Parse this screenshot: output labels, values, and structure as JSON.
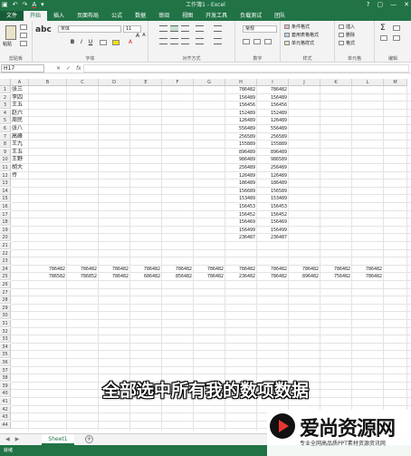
{
  "titlebar": {
    "title": "工作簿1 - Excel",
    "save_icon": "save-icon",
    "undo_icon": "undo-icon",
    "redo_icon": "redo-icon",
    "font_color_icon": "font-color-icon",
    "help_glyph": "?",
    "restore_glyph": "▢",
    "min_glyph": "—",
    "close_glyph": "✕"
  },
  "ribbon_tabs": [
    "文件",
    "开始",
    "插入",
    "页面布局",
    "公式",
    "数据",
    "审阅",
    "视图",
    "开发工具",
    "负载测试",
    "团队"
  ],
  "ribbon": {
    "paste_label": "粘贴",
    "clipboard_label": "剪贴板",
    "font_name": "宋体",
    "font_size": "11",
    "font_label": "字体",
    "bold": "B",
    "italic": "I",
    "underline": "U",
    "grow_font": "A",
    "shrink_font": "A",
    "align_label": "对齐方式",
    "number_format": "常规",
    "number_label": "数字",
    "conditional": "条件格式",
    "table_format": "套用表格格式",
    "cell_styles": "单元格样式",
    "styles_label": "样式",
    "insert": "插入",
    "delete": "删除",
    "format": "格式",
    "cells_label": "单元格",
    "editing_label": "编辑",
    "sum_glyph": "Σ"
  },
  "formula_bar": {
    "name_box": "H17",
    "cancel": "✕",
    "enter": "✓",
    "fx": "fx",
    "value": ""
  },
  "grid": {
    "columns": [
      "A",
      "B",
      "C",
      "D",
      "E",
      "F",
      "G",
      "H",
      "I",
      "J",
      "K",
      "L",
      "M"
    ],
    "rows_count": 44,
    "names": [
      "张三",
      "李四",
      "王五",
      "赵六",
      "周民",
      "张八",
      "高峰",
      "王九",
      "王五",
      "王野",
      "胡大",
      "传"
    ],
    "col_g": [
      "786482",
      "156489",
      "156456",
      "152489",
      "126489",
      "556489",
      "256589",
      "155889",
      "896489",
      "986489",
      "256489",
      "126489",
      "186489",
      "156689",
      "153489",
      "156453",
      "156452",
      "156469",
      "156499",
      "236487"
    ],
    "col_h": [
      "786482",
      "156489",
      "156456",
      "152489",
      "126489",
      "556489",
      "256589",
      "155889",
      "896489",
      "986589",
      "256489",
      "126489",
      "186489",
      "156589",
      "153489",
      "156453",
      "156452",
      "156469",
      "156499",
      "236487"
    ],
    "row24": [
      "786482",
      "786482",
      "786482",
      "786482",
      "786482",
      "786482",
      "786482",
      "786482",
      "786482",
      "786482",
      "786482"
    ],
    "row25": [
      "786582",
      "786852",
      "786482",
      "686482",
      "856482",
      "786482",
      "236482",
      "786482",
      "896482",
      "756482",
      "786482"
    ]
  },
  "sheets": {
    "nav_prev": "◀",
    "nav_next": "▶",
    "tabs": [
      "Sheet1"
    ],
    "add": "+"
  },
  "status": {
    "text": "就绪"
  },
  "subtitle": "全部选中所有我的数项数据",
  "watermark": {
    "brand": "爱尚资源网",
    "slogan": "专业全网高品质PPT素材资源资讯网"
  }
}
